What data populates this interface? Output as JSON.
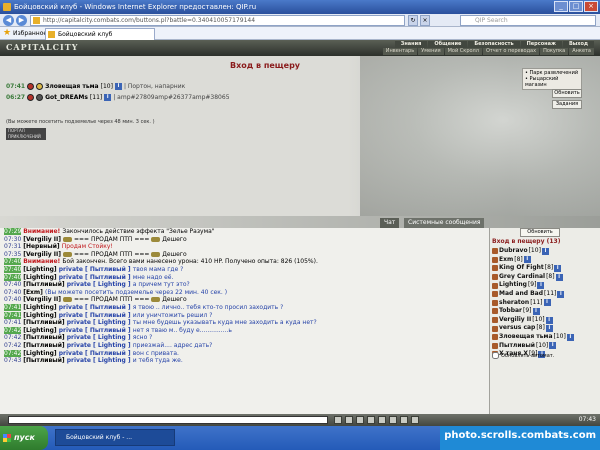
{
  "window": {
    "title": "Бойцовский клуб - Windows Internet Explorer предоставлен: QIP.ru",
    "address": "http://capitalcity.combats.com/buttons.pl?battle=0.340410057179144",
    "search_placeholder": "QIP Search",
    "favorites_label": "Избранное",
    "tab_label": "Бойцовский клуб"
  },
  "game": {
    "logo": "CAPITALCITY",
    "topnav": [
      "Знания",
      "Общение",
      "Безопасность",
      "Персонаж",
      "Выход"
    ],
    "subnav": [
      "Инвентарь",
      "Умения",
      "Мой Скролл",
      "Отчет о переводах",
      "Покупка",
      "Анкета"
    ]
  },
  "location": {
    "title": "Вход в пещеру",
    "links": [
      "Парк развлечений",
      "Рыцарский магазин"
    ],
    "refresh_label": "Обновить",
    "tasks_label": "Задания",
    "players": [
      {
        "time": "07:41",
        "name": "Зловещая тьма",
        "level": "[10]",
        "extra": "| Портон, напарник"
      },
      {
        "time": "06:27",
        "name": "Got_DREAMs",
        "level": "[11]",
        "extra": "| amp#27809amp#26377amp#38065"
      }
    ],
    "note": "(Вы можете посетить подземелье через 48 мин. 3 сек. )",
    "banner": "ПОРТАЛ ПРИКЛЮЧЕНИЙ"
  },
  "chat_tabs": {
    "chat": "Чат",
    "system": "Системные сообщения"
  },
  "chat": {
    "lines": [
      {
        "time": "07:29",
        "hl": true,
        "parts": [
          {
            "t": "Внимание! ",
            "c": "warn"
          },
          {
            "t": "Закончилось действие эффекта \"Зелье Разума\"",
            "c": ""
          }
        ]
      },
      {
        "time": "07:30",
        "hl": false,
        "parts": [
          {
            "t": "[Vergiliy II] ",
            "c": "nick"
          },
          {
            "t": "=== ПРОДАМ ПТП === ",
            "c": "trade"
          },
          {
            "t": "Дешего",
            "c": ""
          }
        ]
      },
      {
        "time": "07:31",
        "hl": false,
        "parts": [
          {
            "t": "[Нервный] ",
            "c": "nick"
          },
          {
            "t": "Продам Стойку!",
            "c": "sys"
          }
        ]
      },
      {
        "time": "07:35",
        "hl": false,
        "parts": [
          {
            "t": "[Vergiliy II] ",
            "c": "nick"
          },
          {
            "t": "=== ПРОДАМ ПТП === ",
            "c": "trade"
          },
          {
            "t": "Дешего",
            "c": ""
          }
        ]
      },
      {
        "time": "07:40",
        "hl": true,
        "parts": [
          {
            "t": "Внимание! ",
            "c": "warn"
          },
          {
            "t": "Бой закончен. Всего вами нанесено урона: 410 HP. Получено опыта: 826 (105%).",
            "c": ""
          }
        ]
      },
      {
        "time": "07:40",
        "hl": true,
        "parts": [
          {
            "t": "[Lighting] ",
            "c": "nick"
          },
          {
            "t": "private [ Пытливый ] ",
            "c": "privp"
          },
          {
            "t": "твоя мама где ?",
            "c": "privtxt"
          }
        ]
      },
      {
        "time": "07:40",
        "hl": true,
        "parts": [
          {
            "t": "[Lighting] ",
            "c": "nick"
          },
          {
            "t": "private [ Пытливый ] ",
            "c": "privp"
          },
          {
            "t": "мне надо её.",
            "c": "privtxt"
          }
        ]
      },
      {
        "time": "07:40",
        "hl": false,
        "parts": [
          {
            "t": "[Пытливый] ",
            "c": "nick"
          },
          {
            "t": "private [ Lighting ] ",
            "c": "privp"
          },
          {
            "t": "а причем тут это?",
            "c": "privtxt"
          }
        ]
      },
      {
        "time": "07:40",
        "hl": false,
        "parts": [
          {
            "t": "[Exm] ",
            "c": "nick"
          },
          {
            "t": "(Вы можете посетить подземелье через 22 мин. 40 сек. )",
            "c": "privtxt"
          }
        ]
      },
      {
        "time": "07:40",
        "hl": false,
        "parts": [
          {
            "t": "[Vergiliy II] ",
            "c": "nick"
          },
          {
            "t": "=== ПРОДАМ ПТП === ",
            "c": "trade"
          },
          {
            "t": "Дешего",
            "c": ""
          }
        ]
      },
      {
        "time": "07:41",
        "hl": true,
        "parts": [
          {
            "t": "[Lighting] ",
            "c": "nick"
          },
          {
            "t": "private [ Пытливый ] ",
            "c": "privp"
          },
          {
            "t": "я твою .. лично.. тебя кто-то просил заходить ?",
            "c": "privtxt"
          }
        ]
      },
      {
        "time": "07:41",
        "hl": true,
        "parts": [
          {
            "t": "[Lighting] ",
            "c": "nick"
          },
          {
            "t": "private [ Пытливый ] ",
            "c": "privp"
          },
          {
            "t": "или уничтожить решил ?",
            "c": "privtxt"
          }
        ]
      },
      {
        "time": "07:41",
        "hl": false,
        "parts": [
          {
            "t": "[Пытливый] ",
            "c": "nick"
          },
          {
            "t": "private [ Lighting ] ",
            "c": "privp"
          },
          {
            "t": "ты мне будешь указывать куда мне заходить а куда нет?",
            "c": "privtxt"
          }
        ]
      },
      {
        "time": "07:42",
        "hl": true,
        "parts": [
          {
            "t": "[Lighting] ",
            "c": "nick"
          },
          {
            "t": "private [ Пытливый ] ",
            "c": "privp"
          },
          {
            "t": "нет я тваю м.. буду е...............ь",
            "c": "privtxt"
          }
        ]
      },
      {
        "time": "07:42",
        "hl": false,
        "parts": [
          {
            "t": "[Пытливый] ",
            "c": "nick"
          },
          {
            "t": "private [ Lighting ] ",
            "c": "privp"
          },
          {
            "t": "ясно ?",
            "c": "privtxt"
          }
        ]
      },
      {
        "time": "07:42",
        "hl": false,
        "parts": [
          {
            "t": "[Пытливый] ",
            "c": "nick"
          },
          {
            "t": "private [ Lighting ] ",
            "c": "privp"
          },
          {
            "t": "приезжай.... адрес дать?",
            "c": "privtxt"
          }
        ]
      },
      {
        "time": "07:42",
        "hl": true,
        "parts": [
          {
            "t": "[Lighting] ",
            "c": "nick"
          },
          {
            "t": "private [ Пытливый ] ",
            "c": "privp"
          },
          {
            "t": "вон с привата.",
            "c": "privtxt"
          }
        ]
      },
      {
        "time": "07:43",
        "hl": false,
        "parts": [
          {
            "t": "[Пытливый] ",
            "c": "nick"
          },
          {
            "t": "private [ Lighting ] ",
            "c": "privp"
          },
          {
            "t": "и тебя туда же.",
            "c": "privtxt"
          }
        ]
      }
    ]
  },
  "who": {
    "refresh_label": "Обновить",
    "title": "Вход в пещеру (13)",
    "players": [
      {
        "name": "Dubravo",
        "level": "[10]"
      },
      {
        "name": "Exm",
        "level": "[8]"
      },
      {
        "name": "King Of Fight",
        "level": "[8]"
      },
      {
        "name": "Grey Cardinal",
        "level": "[8]"
      },
      {
        "name": "Lighting",
        "level": "[9]"
      },
      {
        "name": "Mad and Bad",
        "level": "[11]"
      },
      {
        "name": "sheraton",
        "level": "[11]"
      },
      {
        "name": "Tobbar",
        "level": "[9]"
      },
      {
        "name": "Vergiliy II",
        "level": "[10]"
      },
      {
        "name": "versus cap",
        "level": "[8]"
      },
      {
        "name": "Зловещая тьма",
        "level": "[10]"
      },
      {
        "name": "Пытливый",
        "level": "[10]"
      },
      {
        "name": "X таня X",
        "level": "[9]"
      }
    ],
    "auto_label": "Обновлять автомат."
  },
  "chatbar": {
    "clock": "07:43"
  },
  "taskbar": {
    "start": "пуск",
    "task": "Бойцовский клуб - ...",
    "watermark": "photo.scrolls.combats.com"
  }
}
